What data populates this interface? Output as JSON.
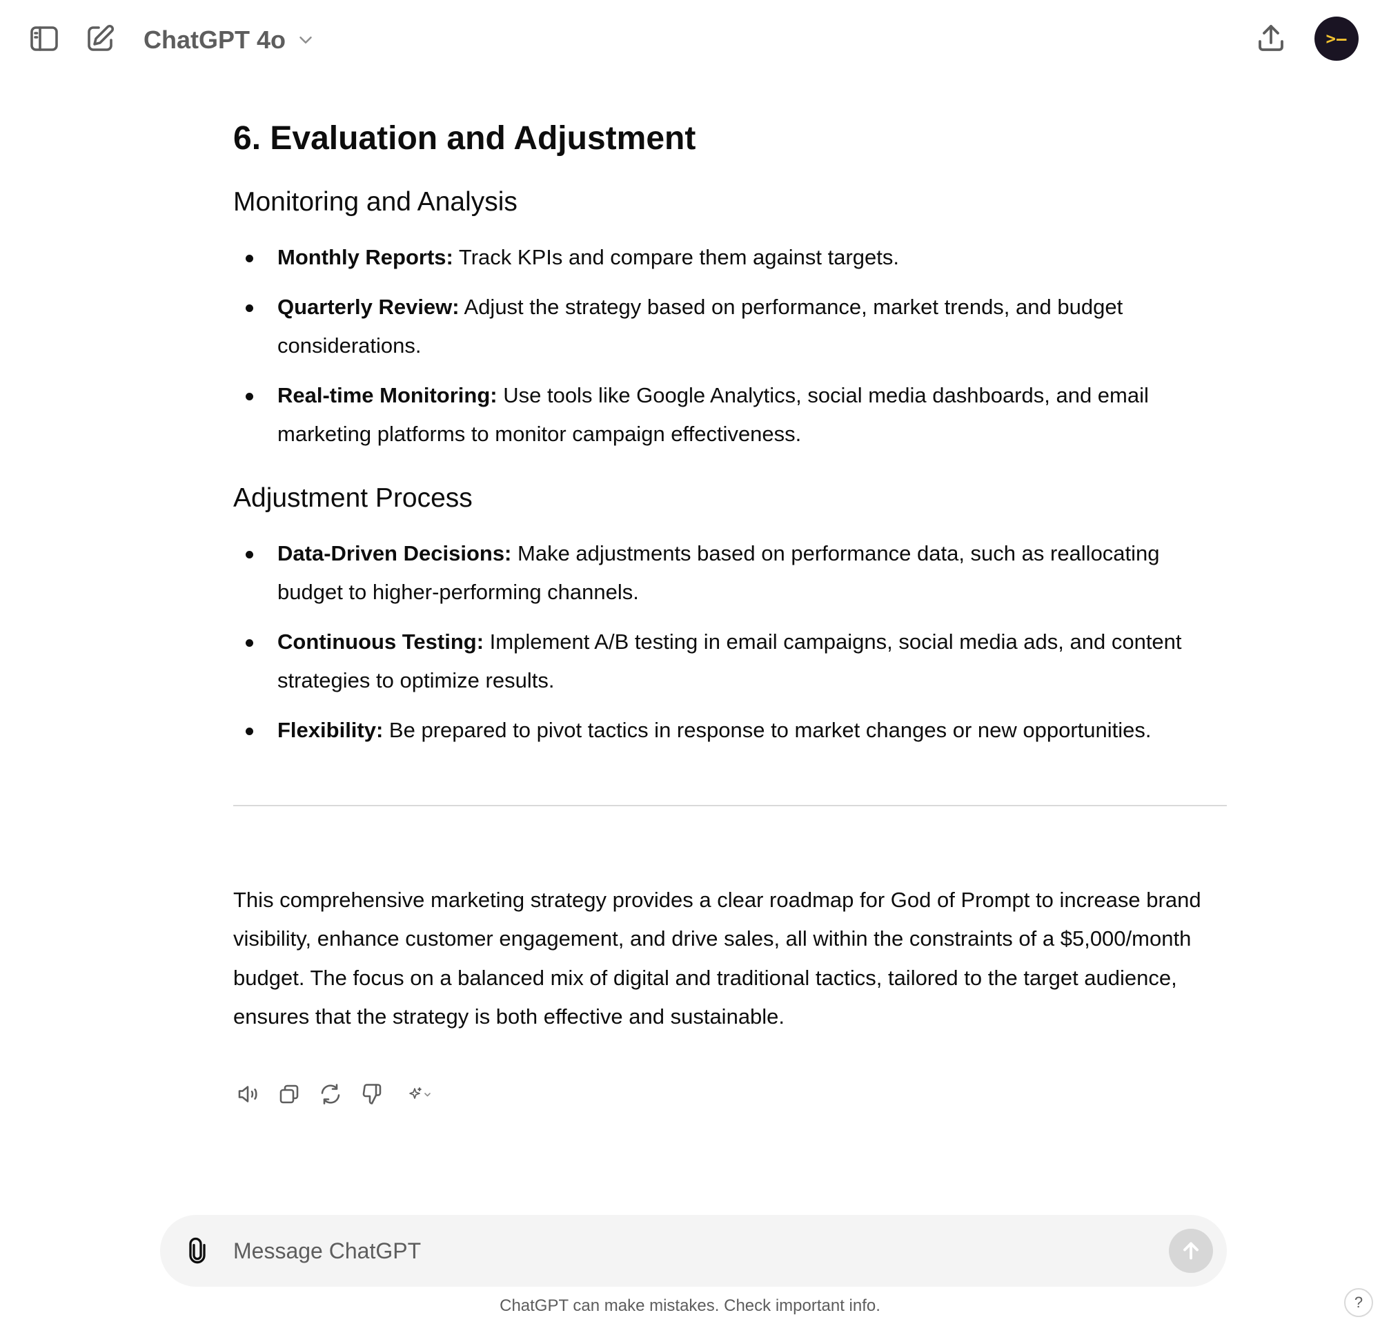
{
  "header": {
    "model_name": "ChatGPT 4o",
    "avatar_text": ">–",
    "icons": [
      "sidebar-icon",
      "new-chat-icon",
      "chevron-down-icon",
      "share-icon"
    ]
  },
  "message": {
    "section_title": "6. Evaluation and Adjustment",
    "monitoring": {
      "title": "Monitoring and Analysis",
      "items": [
        {
          "label": "Monthly Reports:",
          "text": " Track KPIs and compare them against targets."
        },
        {
          "label": "Quarterly Review:",
          "text": " Adjust the strategy based on performance, market trends, and budget considerations."
        },
        {
          "label": "Real-time Monitoring:",
          "text": " Use tools like Google Analytics, social media dashboards, and email marketing platforms to monitor campaign effectiveness."
        }
      ]
    },
    "adjustment": {
      "title": "Adjustment Process",
      "items": [
        {
          "label": "Data-Driven Decisions:",
          "text": " Make adjustments based on performance data, such as reallocating budget to higher-performing channels."
        },
        {
          "label": "Continuous Testing:",
          "text": " Implement A/B testing in email campaigns, social media ads, and content strategies to optimize results."
        },
        {
          "label": "Flexibility:",
          "text": " Be prepared to pivot tactics in response to market changes or new opportunities."
        }
      ]
    },
    "summary": "This comprehensive marketing strategy provides a clear roadmap for God of Prompt to increase brand visibility, enhance customer engagement, and drive sales, all within the constraints of a $5,000/month budget. The focus on a balanced mix of digital and traditional tactics, tailored to the target audience, ensures that the strategy is both effective and sustainable.",
    "action_icons": [
      "read-aloud-icon",
      "copy-icon",
      "regenerate-icon",
      "thumbs-down-icon",
      "sparkle-icon"
    ]
  },
  "composer": {
    "placeholder": "Message ChatGPT",
    "value": ""
  },
  "footer": {
    "disclaimer": "ChatGPT can make mistakes. Check important info.",
    "help_label": "?"
  },
  "colors": {
    "text": "#0d0d0d",
    "muted": "#5d5d5d",
    "composer_bg": "#f4f4f4",
    "send_disabled": "#d7d7d7",
    "avatar_bg": "#1a1423",
    "avatar_fg": "#f2c230"
  }
}
